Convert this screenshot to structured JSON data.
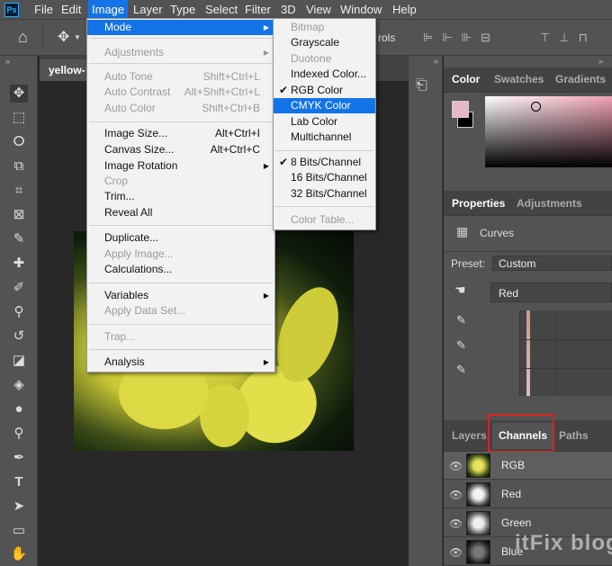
{
  "menubar": {
    "items": [
      "File",
      "Edit",
      "Image",
      "Layer",
      "Type",
      "Select",
      "Filter",
      "3D",
      "View",
      "Window",
      "Help"
    ],
    "logo": "Ps"
  },
  "options": {
    "controls_fragment": "rols"
  },
  "document": {
    "tab": "yellow-"
  },
  "image_menu": {
    "mode": "Mode",
    "adjustments": "Adjustments",
    "auto_tone": "Auto Tone",
    "auto_tone_sc": "Shift+Ctrl+L",
    "auto_contrast": "Auto Contrast",
    "auto_contrast_sc": "Alt+Shift+Ctrl+L",
    "auto_color": "Auto Color",
    "auto_color_sc": "Shift+Ctrl+B",
    "image_size": "Image Size...",
    "image_size_sc": "Alt+Ctrl+I",
    "canvas_size": "Canvas Size...",
    "canvas_size_sc": "Alt+Ctrl+C",
    "image_rotation": "Image Rotation",
    "crop": "Crop",
    "trim": "Trim...",
    "reveal_all": "Reveal All",
    "duplicate": "Duplicate...",
    "apply_image": "Apply Image...",
    "calculations": "Calculations...",
    "variables": "Variables",
    "apply_data_set": "Apply Data Set...",
    "trap": "Trap...",
    "analysis": "Analysis"
  },
  "mode_menu": {
    "bitmap": "Bitmap",
    "grayscale": "Grayscale",
    "duotone": "Duotone",
    "indexed": "Indexed Color...",
    "rgb": "RGB Color",
    "cmyk": "CMYK Color",
    "lab": "Lab Color",
    "multichannel": "Multichannel",
    "bits8": "8 Bits/Channel",
    "bits16": "16 Bits/Channel",
    "bits32": "32 Bits/Channel",
    "color_table": "Color Table...",
    "check": "✔"
  },
  "color_panel": {
    "tabs": [
      "Color",
      "Swatches",
      "Gradients"
    ],
    "fg": "#e8b9c4",
    "bg": "#000000",
    "hue": "#f1a0b4"
  },
  "properties": {
    "tabs": [
      "Properties",
      "Adjustments"
    ],
    "type": "Curves",
    "preset_label": "Preset:",
    "preset_value": "Custom",
    "channel_value": "Red"
  },
  "channels_panel": {
    "tabs": [
      "Layers",
      "Channels",
      "Paths"
    ],
    "rows": [
      "RGB",
      "Red",
      "Green",
      "Blue"
    ]
  },
  "watermark": "itFix blog"
}
